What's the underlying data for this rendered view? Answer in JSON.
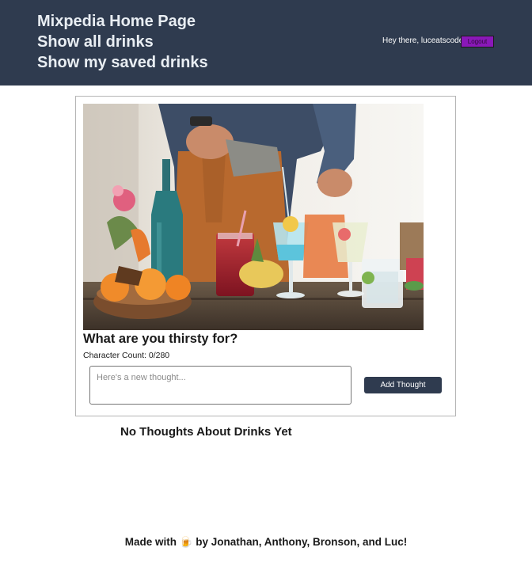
{
  "nav": {
    "home": "Mixpedia Home Page",
    "all_drinks": "Show all drinks",
    "saved_drinks": "Show my saved drinks"
  },
  "user": {
    "greeting": "Hey there, luceatscode!",
    "logout_label": "Logout"
  },
  "thought_form": {
    "prompt": "What are you thirsty for?",
    "char_count": "Character Count: 0/280",
    "input_value": "",
    "input_placeholder": "Here's a new thought...",
    "submit_label": "Add Thought"
  },
  "thoughts": {
    "empty_message": "No Thoughts About Drinks Yet"
  },
  "footer": {
    "text": "Made with 🍺 by Jonathan, Anthony, Bronson, and Luc!"
  },
  "colors": {
    "header_bg": "#2f3b4f",
    "logout_bg": "#8a18b8",
    "button_bg": "#2f3b4f"
  }
}
